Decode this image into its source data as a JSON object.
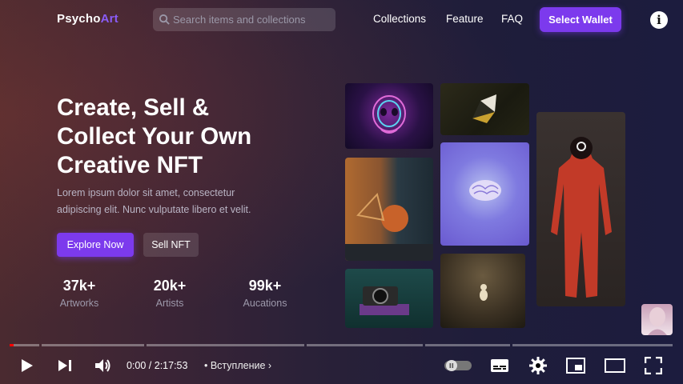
{
  "header": {
    "logo": {
      "prefix": "Psycho",
      "suffix": "Art"
    },
    "search": {
      "placeholder": "Search items and collections"
    },
    "nav": [
      "Collections",
      "Feature",
      "FAQ"
    ],
    "wallet_button": "Select Wallet"
  },
  "hero": {
    "title_lines": [
      "Create, Sell &",
      "Collect Your Own",
      "Creative NFT"
    ],
    "subtitle_lines": [
      "Lorem ipsum dolor sit amet, consectetur",
      "adipiscing elit. Nunc vulputate libero et velit."
    ],
    "explore_button": "Explore Now",
    "sell_button": "Sell NFT",
    "stats": [
      {
        "value": "37k+",
        "label": "Artworks"
      },
      {
        "value": "20k+",
        "label": "Artists"
      },
      {
        "value": "99k+",
        "label": "Aucations"
      }
    ]
  },
  "gallery": {
    "items": [
      "neon-skull-art",
      "dark-gem-art",
      "orange-sculpture-art",
      "glowing-brain-art",
      "red-jumpsuit-figure-art",
      "camera-on-book-art",
      "small-figure-art"
    ]
  },
  "player": {
    "time": "0:00 / 2:17:53",
    "chapter": "• Вступление",
    "progress_fraction": 0.0,
    "icons": [
      "play-icon",
      "next-icon",
      "volume-icon",
      "autoplay-toggle-icon",
      "subtitles-icon",
      "settings-icon",
      "miniplayer-icon",
      "theater-icon",
      "fullscreen-icon"
    ]
  },
  "colors": {
    "accent": "#7c3aed",
    "progress": "#ff0000"
  }
}
